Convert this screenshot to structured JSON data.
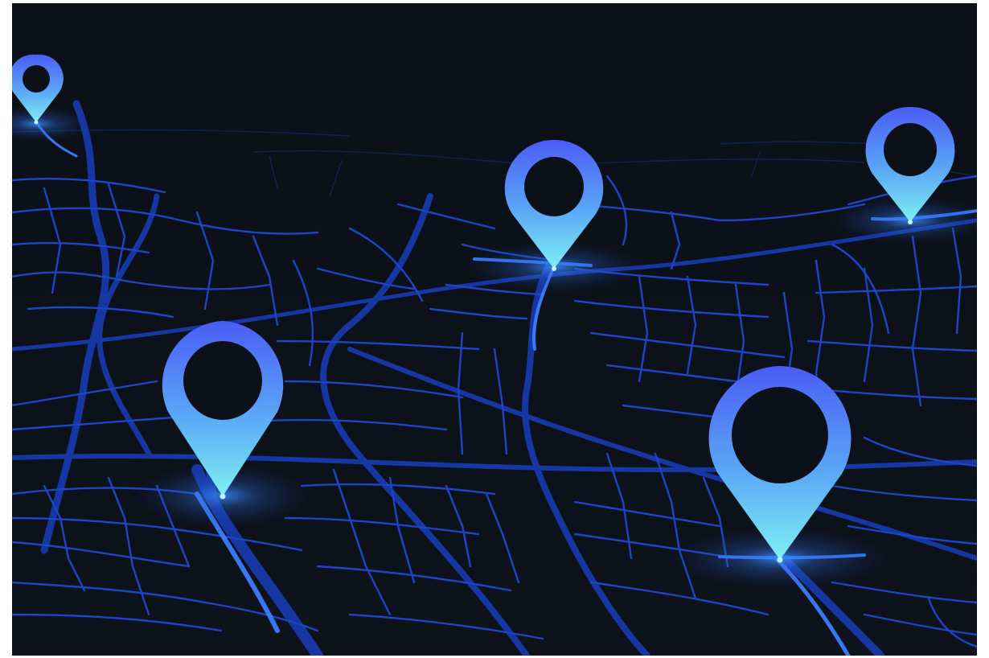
{
  "image": {
    "subject": "dark-city-map-with-location-pins",
    "background_color": "#0c1119"
  },
  "colors": {
    "road_major": "#1a3fb5",
    "road_minor": "#1f46c8",
    "road_highlight": "#3a8cff",
    "pin_top": "#4a5cf5",
    "pin_bottom": "#7ff0f2",
    "glow": "#2f8dff"
  },
  "pins": [
    {
      "name": "pin-top-left",
      "icon": "location-pin-icon"
    },
    {
      "name": "pin-top-center",
      "icon": "location-pin-icon"
    },
    {
      "name": "pin-top-right",
      "icon": "location-pin-icon"
    },
    {
      "name": "pin-bottom-left",
      "icon": "location-pin-icon"
    },
    {
      "name": "pin-bottom-right",
      "icon": "location-pin-icon"
    }
  ]
}
